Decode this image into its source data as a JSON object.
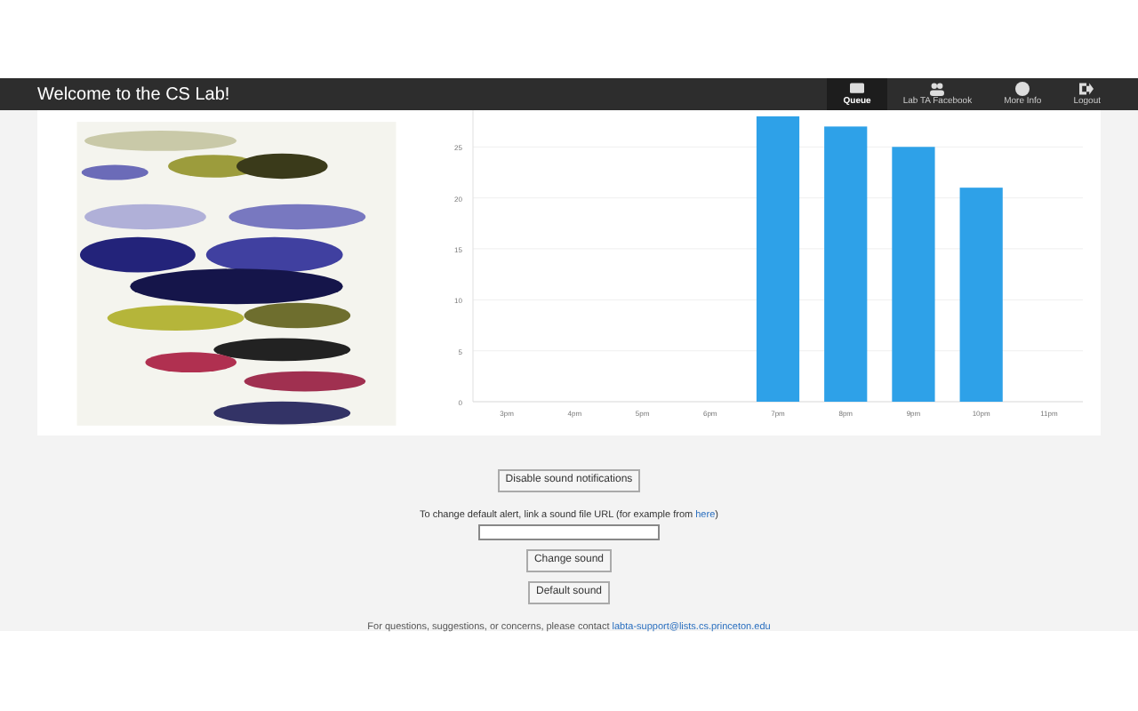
{
  "header": {
    "title": "Welcome to the CS Lab!",
    "nav": [
      {
        "label": "Queue",
        "kind": "queue",
        "selected": true
      },
      {
        "label": "Lab TA Facebook",
        "kind": "people",
        "selected": false
      },
      {
        "label": "More Info",
        "kind": "info",
        "selected": false
      },
      {
        "label": "Logout",
        "kind": "logout",
        "selected": false
      }
    ]
  },
  "chart_data": {
    "type": "bar",
    "categories": [
      "3pm",
      "4pm",
      "5pm",
      "6pm",
      "7pm",
      "8pm",
      "9pm",
      "10pm",
      "11pm"
    ],
    "grid": true,
    "series": [
      {
        "color": "#2ea1e8",
        "values": [
          0,
          0,
          0,
          0,
          28,
          27,
          25,
          21,
          0
        ]
      }
    ],
    "ylim": [
      0,
      28.6
    ],
    "yticks": [
      0,
      5,
      10,
      15,
      20,
      25
    ]
  },
  "sound": {
    "disable_button": "Disable sound notifications",
    "hint": "To change default alert, link a sound file URL (for example from",
    "hint_link": "here",
    "hint_end": ")",
    "change_button": "Change sound",
    "default_button": "Default sound"
  },
  "footer": {
    "text": "For questions, suggestions, or concerns, please contact",
    "link": "labta-support@lists.cs.princeton.edu"
  }
}
